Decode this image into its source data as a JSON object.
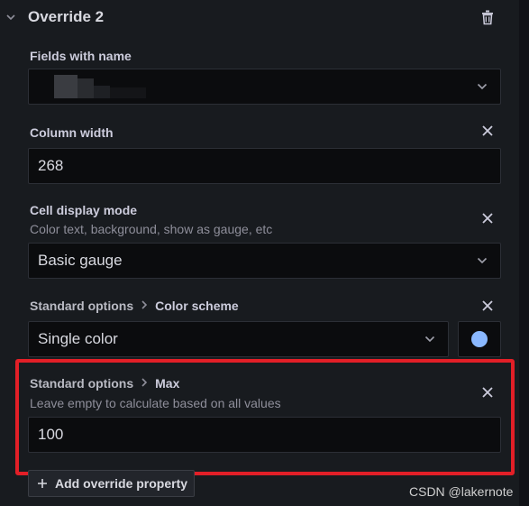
{
  "override": {
    "title": "Override 2"
  },
  "fields_with_name": {
    "label": "Fields with name",
    "value": ""
  },
  "column_width": {
    "label": "Column width",
    "value": "268"
  },
  "cell_display_mode": {
    "label": "Cell display mode",
    "description": "Color text, background, show as gauge, etc",
    "value": "Basic gauge"
  },
  "color_scheme": {
    "crumb_parent": "Standard options",
    "crumb_child": "Color scheme",
    "value": "Single color",
    "swatch_color": "#8ab8ff"
  },
  "max": {
    "crumb_parent": "Standard options",
    "crumb_child": "Max",
    "description": "Leave empty to calculate based on all values",
    "value": "100"
  },
  "add_override": {
    "label": "Add override property"
  },
  "watermark": "CSDN @lakernote",
  "colors": {
    "highlight_border": "#e21f27",
    "panel_bg": "#181b1f",
    "input_bg": "#0b0c0e"
  },
  "icons": {
    "collapse": "chevron-down-icon",
    "delete": "trash-icon",
    "remove": "close-icon",
    "dropdown": "chevron-down-icon",
    "add": "plus-icon"
  }
}
